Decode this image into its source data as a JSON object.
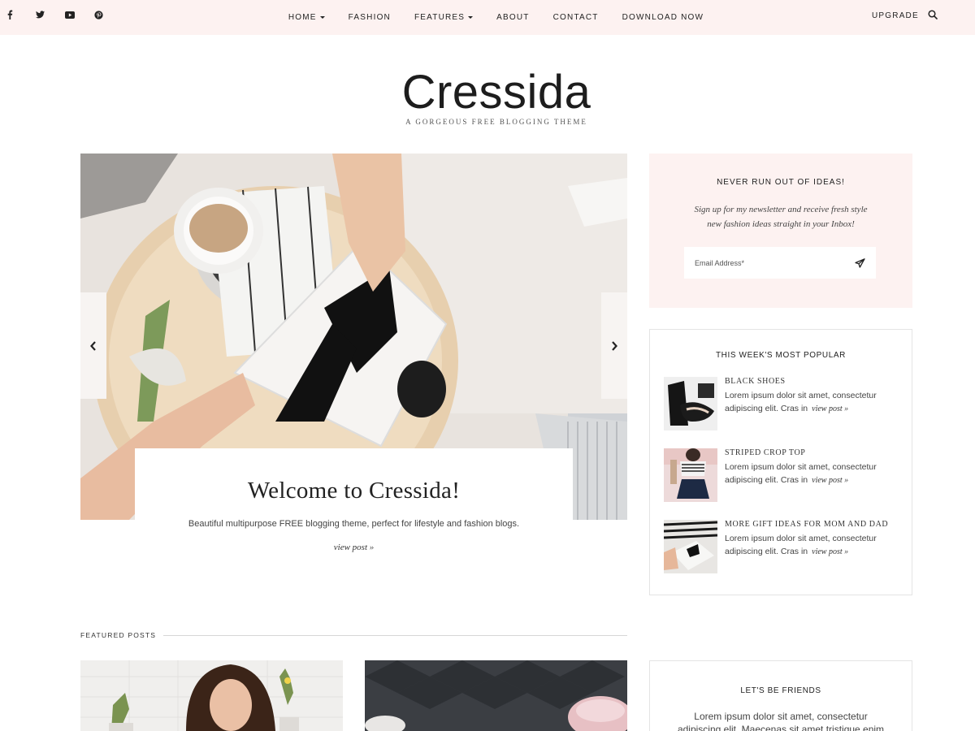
{
  "social": [
    {
      "icon": "facebook-icon"
    },
    {
      "icon": "twitter-icon"
    },
    {
      "icon": "youtube-icon"
    },
    {
      "icon": "pinterest-icon"
    }
  ],
  "nav": {
    "items": [
      {
        "label": "HOME",
        "has_dropdown": true
      },
      {
        "label": "FASHION",
        "has_dropdown": false
      },
      {
        "label": "FEATURES",
        "has_dropdown": true
      },
      {
        "label": "ABOUT",
        "has_dropdown": false
      },
      {
        "label": "CONTACT",
        "has_dropdown": false
      },
      {
        "label": "DOWNLOAD NOW",
        "has_dropdown": false
      }
    ],
    "upgrade": "UPGRADE",
    "search_icon": "search-icon"
  },
  "site": {
    "title": "Cressida",
    "tagline": "A GORGEOUS FREE BLOGGING THEME"
  },
  "hero": {
    "title": "Welcome to Cressida!",
    "description": "Beautiful multipurpose FREE blogging theme, perfect for lifestyle and fashion blogs.",
    "more": "view post »",
    "prev_icon": "chevron-left-icon",
    "next_icon": "chevron-right-icon"
  },
  "newsletter": {
    "title": "NEVER RUN OUT OF IDEAS!",
    "line1": "Sign up for my newsletter and receive fresh style",
    "line2": "new fashion ideas straight in your Inbox!",
    "placeholder": "Email Address*",
    "send_icon": "paper-plane-icon"
  },
  "popular": {
    "title": "THIS WEEK'S MOST POPULAR",
    "items": [
      {
        "name": "BLACK SHOES",
        "text": "Lorem ipsum dolor sit amet, consectetur adipiscing elit. Cras in",
        "more": "view post »"
      },
      {
        "name": "STRIPED CROP TOP",
        "text": "Lorem ipsum dolor sit amet, consectetur adipiscing elit. Cras in",
        "more": "view post »"
      },
      {
        "name": "MORE GIFT IDEAS FOR MOM AND DAD",
        "text": "Lorem ipsum dolor sit amet, consectetur adipiscing elit. Cras in",
        "more": "view post »"
      }
    ]
  },
  "featured": {
    "label": "FEATURED POSTS"
  },
  "friends": {
    "title": "LET'S BE FRIENDS",
    "text": "Lorem ipsum dolor sit amet, consectetur adipiscing elit. Maecenas sit amet tristique enim"
  },
  "colors": {
    "topbar_bg": "#fdf2f1",
    "newsletter_bg": "#fdf2f1",
    "text": "#222222"
  }
}
